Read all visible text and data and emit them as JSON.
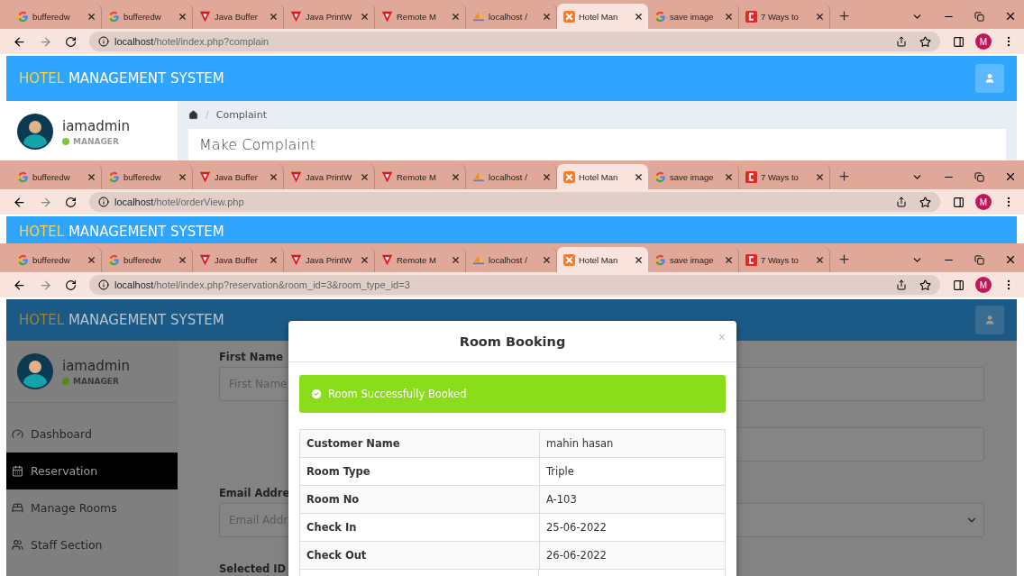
{
  "windows": [
    {
      "tabs": [
        {
          "title": "bufferedw",
          "kind": "google",
          "selected": false
        },
        {
          "title": "bufferedw",
          "kind": "google",
          "selected": false
        },
        {
          "title": "Java Buffer",
          "kind": "vivaldi",
          "selected": false
        },
        {
          "title": "Java PrintW",
          "kind": "vivaldi",
          "selected": false
        },
        {
          "title": "Remote M",
          "kind": "vivaldi",
          "selected": false
        },
        {
          "title": "localhost /",
          "kind": "pma",
          "selected": false
        },
        {
          "title": "Hotel Man",
          "kind": "xampp",
          "selected": true
        },
        {
          "title": "save image",
          "kind": "google",
          "selected": false
        },
        {
          "title": "7 Ways to",
          "kind": "cblog",
          "selected": false
        }
      ],
      "url_host": "localhost",
      "url_path": "/hotel/index.php?complain",
      "avatar": "M",
      "app": {
        "brand_accent": "HOTEL",
        "brand": "MANAGEMENT SYSTEM",
        "user": {
          "name": "iamadmin",
          "role": "MANAGER"
        },
        "breadcrumb_separator": "/",
        "breadcrumb": "Complaint",
        "panel_title": "Make Complaint"
      }
    },
    {
      "tabs": [
        {
          "title": "bufferedw",
          "kind": "google",
          "selected": false
        },
        {
          "title": "bufferedw",
          "kind": "google",
          "selected": false
        },
        {
          "title": "Java Buffer",
          "kind": "vivaldi",
          "selected": false
        },
        {
          "title": "Java PrintW",
          "kind": "vivaldi",
          "selected": false
        },
        {
          "title": "Remote M",
          "kind": "vivaldi",
          "selected": false
        },
        {
          "title": "localhost /",
          "kind": "pma",
          "selected": false
        },
        {
          "title": "Hotel Man",
          "kind": "xampp",
          "selected": true
        },
        {
          "title": "save image",
          "kind": "google",
          "selected": false
        },
        {
          "title": "7 Ways to",
          "kind": "cblog",
          "selected": false
        }
      ],
      "url_host": "localhost",
      "url_path": "/hotel/orderView.php",
      "avatar": "M",
      "app": {
        "brand_accent": "HOTEL",
        "brand": "MANAGEMENT SYSTEM"
      }
    },
    {
      "tabs": [
        {
          "title": "bufferedw",
          "kind": "google",
          "selected": false
        },
        {
          "title": "bufferedw",
          "kind": "google",
          "selected": false
        },
        {
          "title": "Java Buffer",
          "kind": "vivaldi",
          "selected": false
        },
        {
          "title": "Java PrintW",
          "kind": "vivaldi",
          "selected": false
        },
        {
          "title": "Remote M",
          "kind": "vivaldi",
          "selected": false
        },
        {
          "title": "localhost /",
          "kind": "pma",
          "selected": false
        },
        {
          "title": "Hotel Man",
          "kind": "xampp",
          "selected": true
        },
        {
          "title": "save image",
          "kind": "google",
          "selected": false
        },
        {
          "title": "7 Ways to",
          "kind": "cblog",
          "selected": false
        }
      ],
      "url_host": "localhost",
      "url_path": "/hotel/index.php?reservation&room_id=3&room_type_id=3",
      "avatar": "M",
      "app": {
        "brand_accent": "HOTEL",
        "brand": "MANAGEMENT SYSTEM",
        "user": {
          "name": "iamadmin",
          "role": "MANAGER"
        },
        "nav": [
          {
            "label": "Dashboard",
            "kind": "dashboard",
            "selected": false
          },
          {
            "label": "Reservation",
            "kind": "calendar",
            "selected": true
          },
          {
            "label": "Manage Rooms",
            "kind": "bed",
            "selected": false
          },
          {
            "label": "Staff Section",
            "kind": "users",
            "selected": false
          }
        ],
        "form": {
          "rows": [
            {
              "left": {
                "label": "First Name",
                "placeholder": "First Name",
                "kind": "input"
              },
              "right": {
                "kind": "input"
              }
            },
            {
              "right": {
                "kind": "input"
              }
            },
            {
              "left": {
                "label": "Email Addre",
                "placeholder": "Email Addr",
                "kind": "input"
              },
              "right": {
                "kind": "select"
              }
            },
            {
              "left": {
                "label": "Selected ID"
              }
            }
          ]
        },
        "modal": {
          "title": "Room Booking",
          "close": "×",
          "alert": "Room Successfully Booked",
          "rows": [
            {
              "label": "Customer Name",
              "value": "mahin hasan"
            },
            {
              "label": "Room Type",
              "value": "Triple"
            },
            {
              "label": "Room No",
              "value": "A-103"
            },
            {
              "label": "Check In",
              "value": "25-06-2022"
            },
            {
              "label": "Check Out",
              "value": "26-06-2022"
            }
          ]
        }
      }
    }
  ]
}
